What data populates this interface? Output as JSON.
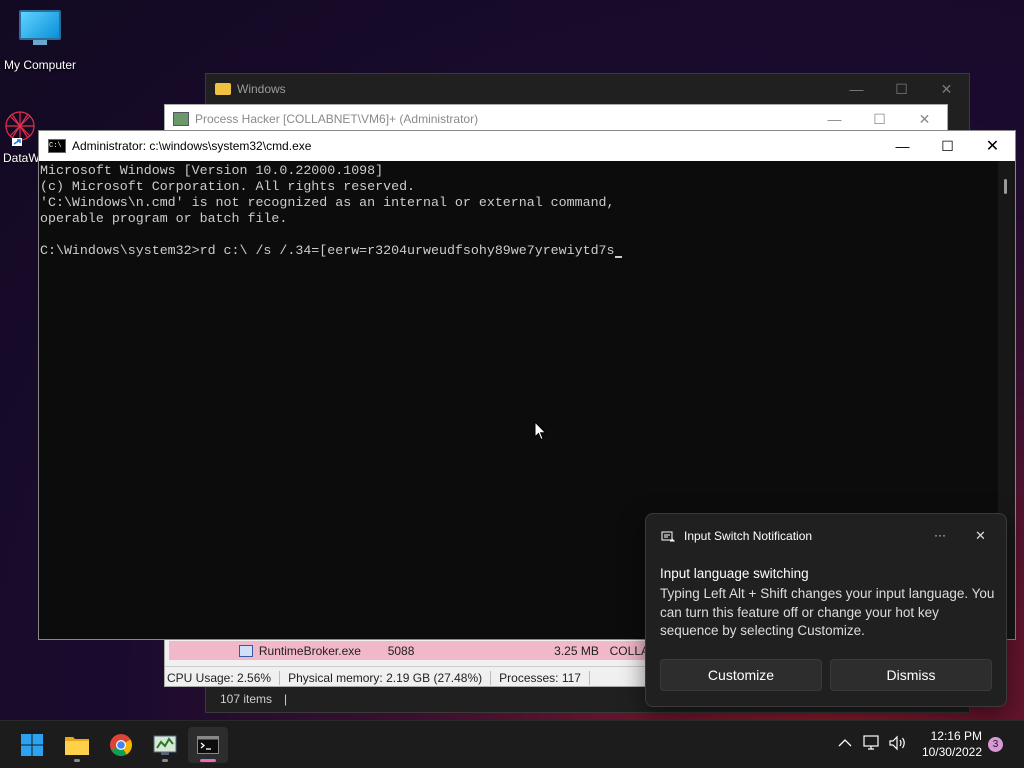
{
  "desktop": {
    "icons": [
      {
        "label": "My Computer"
      },
      {
        "label": "DataW"
      }
    ]
  },
  "windows": {
    "explorer": {
      "title": "Windows",
      "status_items": "107 items",
      "status_sep": "|"
    },
    "process_hacker": {
      "title": "Process Hacker [COLLABNET\\VM6]+ (Administrator)",
      "row": {
        "name": "RuntimeBroker.exe",
        "pid": "5088",
        "memory": "3.25 MB",
        "user": "COLLA"
      },
      "status": {
        "cpu": "CPU Usage: 2.56%",
        "memory": "Physical memory: 2.19 GB (27.48%)",
        "processes": "Processes: 117"
      }
    },
    "cmd": {
      "title": "Administrator: c:\\windows\\system32\\cmd.exe",
      "lines": [
        "Microsoft Windows [Version 10.0.22000.1098]",
        "(c) Microsoft Corporation. All rights reserved.",
        "'C:\\Windows\\n.cmd' is not recognized as an internal or external command,",
        "operable program or batch file.",
        "",
        "C:\\Windows\\system32>rd c:\\ /s /.34=[eerw=r3204urweudfsohy89we7yrewiytd7s"
      ]
    }
  },
  "notification": {
    "app_name": "Input Switch Notification",
    "more": "···",
    "close": "✕",
    "heading": "Input language switching",
    "body": "Typing Left Alt + Shift changes your input language. You can turn this feature off or change your hot key sequence by selecting Customize.",
    "customize_label": "Customize",
    "dismiss_label": "Dismiss"
  },
  "taskbar": {
    "apps": [
      "start-icon",
      "file-explorer-icon",
      "chrome-icon",
      "process-hacker-icon",
      "cmd-icon"
    ],
    "time": "12:16 PM",
    "date": "10/30/2022",
    "badge": "3"
  },
  "colors": {
    "accent": "#0078d4",
    "cmd_bg": "#0c0c0c",
    "cmd_text": "#cccccc",
    "taskbar": "#1c1c1c"
  }
}
